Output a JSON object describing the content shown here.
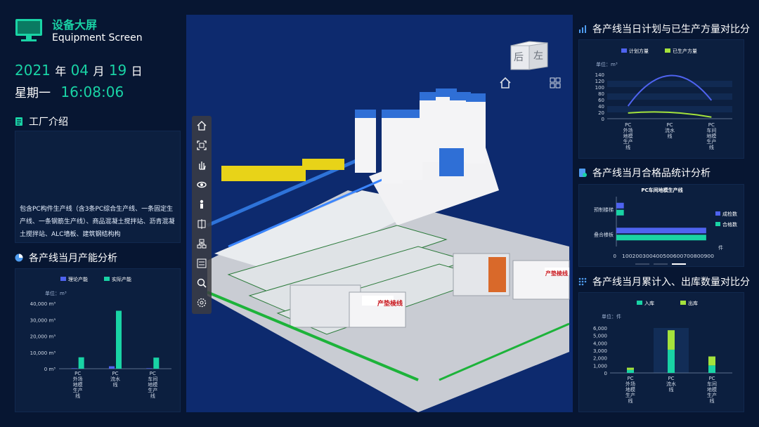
{
  "header": {
    "title": "设备大屏",
    "subtitle": "Equipment Screen",
    "year": "2021",
    "year_suffix": "年",
    "month": "04",
    "month_suffix": "月",
    "day": "19",
    "day_suffix": "日",
    "weekday": "星期一",
    "time": "16:08:06"
  },
  "colors": {
    "accent": "#19d3a5",
    "blue_series": "#4f63f0",
    "green_series": "#19d3a5",
    "lime_series": "#a4e23c",
    "background": "#071632"
  },
  "factory": {
    "title": "工厂介绍",
    "text": "包含PC构件生产线（含3条PC综合生产线、一条固定生产线、一条钢筋生产线）、商品混凝土搅拌站、沥青混凝土搅拌站、ALC墙板、建筑钢结构构"
  },
  "viewport": {
    "cube_face_1": "后",
    "cube_face_2": "左",
    "home_icon": "home-icon",
    "grid_icon": "grid-icon",
    "toolbar": [
      "home-icon",
      "fit-view-icon",
      "pan-hand-icon",
      "orbit-icon",
      "person-icon",
      "section-icon",
      "layers-icon",
      "list-icon",
      "search-icon",
      "settings-icon"
    ],
    "sign_text": "产垫棱线",
    "sign_text_2": "产垫棱线"
  },
  "capacity_chart": {
    "title": "各产线当月产能分析",
    "unit": "单位：m³",
    "legend": [
      "理论产能",
      "实际产能"
    ],
    "chart_data": {
      "type": "bar",
      "categories": [
        "PC外场地模生产线",
        "PC流水线",
        "PC车间地模生产线"
      ],
      "category_lines": [
        [
          "PC",
          "外场",
          "地模",
          "生产",
          "线"
        ],
        [
          "PC",
          "流水",
          "线"
        ],
        [
          "PC",
          "车间",
          "地模",
          "生产",
          "线"
        ]
      ],
      "series": [
        {
          "name": "理论产能",
          "values": [
            300,
            1500,
            300
          ]
        },
        {
          "name": "实际产能",
          "values": [
            7000,
            35500,
            6800
          ]
        }
      ],
      "ylim": [
        0,
        40000
      ],
      "yticks": [
        "0 m³",
        "10,000 m³",
        "20,000 m³",
        "30,000 m³",
        "40,000 m³"
      ],
      "ytick_values": [
        0,
        10000,
        20000,
        30000,
        40000
      ],
      "legend_position": "top"
    }
  },
  "plan_chart": {
    "title": "各产线当日计划与已生产方量对比分",
    "unit": "单位：m³",
    "legend": [
      "计划方量",
      "已生产方量"
    ],
    "chart_data": {
      "type": "line",
      "categories": [
        "PC外场地模生产线",
        "PC流水线",
        "PC车间地模生产线"
      ],
      "category_lines": [
        [
          "PC",
          "外场",
          "地模",
          "生产",
          "线"
        ],
        [
          "PC",
          "流水",
          "线"
        ],
        [
          "PC",
          "车间",
          "地模",
          "生产",
          "线"
        ]
      ],
      "series": [
        {
          "name": "计划方量",
          "values": [
            40,
            135,
            58
          ]
        },
        {
          "name": "已生产方量",
          "values": [
            18,
            20,
            5
          ]
        }
      ],
      "ylim": [
        0,
        140
      ],
      "yticks": [
        "0",
        "20",
        "40",
        "60",
        "80",
        "100",
        "120",
        "140"
      ],
      "ytick_values": [
        0,
        20,
        40,
        60,
        80,
        100,
        120,
        140
      ],
      "legend_position": "top"
    }
  },
  "quality_chart": {
    "title": "各产线当月合格品统计分析",
    "subtitle": "PC车间地模生产线",
    "legend": [
      "成检数",
      "合格数"
    ],
    "x_unit": "件",
    "chart_data": {
      "type": "bar",
      "orientation": "horizontal",
      "categories": [
        "预制楼梯",
        "叠合楼板"
      ],
      "series": [
        {
          "name": "成检数",
          "values": [
            70,
            840
          ]
        },
        {
          "name": "合格数",
          "values": [
            70,
            840
          ]
        }
      ],
      "xlim": [
        0,
        900
      ],
      "xticks": [
        "0",
        "100",
        "200",
        "300",
        "400",
        "500",
        "600",
        "700",
        "800",
        "900"
      ],
      "xtick_values": [
        0,
        100,
        200,
        300,
        400,
        500,
        600,
        700,
        800,
        900
      ]
    }
  },
  "inout_chart": {
    "title": "各产线当月累计入、出库数量对比分",
    "unit": "单位：件",
    "legend": [
      "入库",
      "出库"
    ],
    "chart_data": {
      "type": "bar",
      "stacked": true,
      "categories": [
        "PC外场地模生产线",
        "PC流水线",
        "PC车间地模生产线"
      ],
      "category_lines": [
        [
          "PC",
          "外场",
          "地模",
          "生产",
          "线"
        ],
        [
          "PC",
          "流水",
          "线"
        ],
        [
          "PC",
          "车间",
          "地模",
          "生产",
          "线"
        ]
      ],
      "series": [
        {
          "name": "入库",
          "values": [
            400,
            3100,
            1000
          ]
        },
        {
          "name": "出库",
          "values": [
            300,
            2600,
            1200
          ]
        }
      ],
      "ylim": [
        0,
        6000
      ],
      "yticks": [
        "0",
        "1,000",
        "2,000",
        "3,000",
        "4,000",
        "5,000",
        "6,000"
      ],
      "ytick_values": [
        0,
        1000,
        2000,
        3000,
        4000,
        5000,
        6000
      ],
      "legend_position": "top"
    }
  }
}
